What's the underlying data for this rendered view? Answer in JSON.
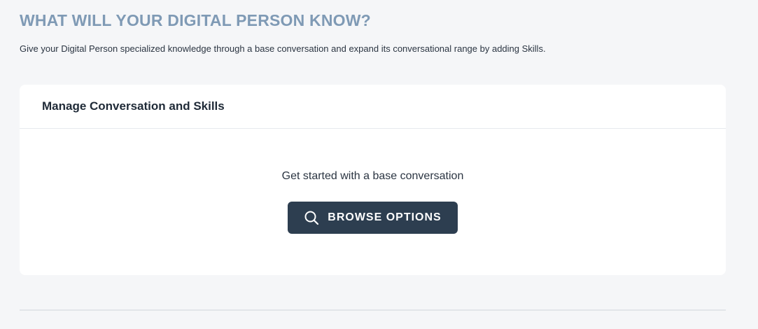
{
  "header": {
    "title": "WHAT WILL YOUR DIGITAL PERSON KNOW?",
    "subtitle": "Give your Digital Person specialized knowledge through a base conversation and expand its conversational range by adding Skills."
  },
  "card": {
    "title": "Manage Conversation and Skills",
    "empty_state_text": "Get started with a base conversation",
    "browse_button": {
      "label": "BROWSE OPTIONS",
      "icon": "search-icon"
    }
  },
  "colors": {
    "title": "#7f9ab5",
    "button_bg": "#2d3e50",
    "page_bg": "#f5f6f8"
  }
}
